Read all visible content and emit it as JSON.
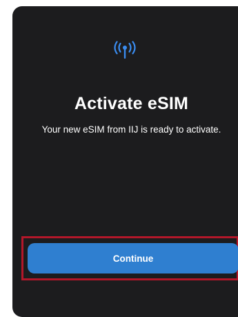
{
  "dialog": {
    "icon": "antenna-signal-icon",
    "title": "Activate eSIM",
    "message": "Your new eSIM from IIJ is ready to activate.",
    "continue_label": "Continue"
  },
  "colors": {
    "background": "#1c1c1e",
    "accent": "#2f7fd0",
    "highlight": "#b3172a"
  }
}
